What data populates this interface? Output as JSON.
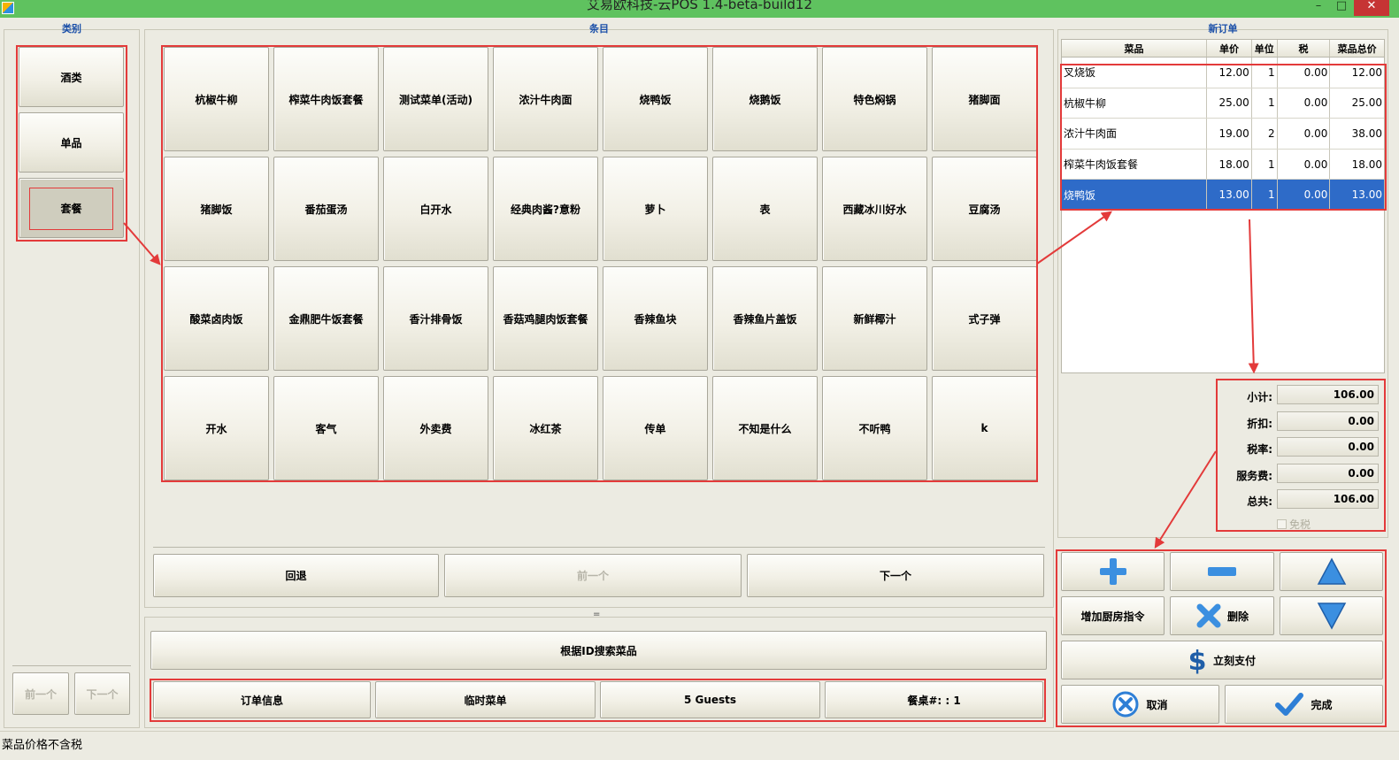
{
  "window": {
    "title": "艾易欧科技-云POS 1.4-beta-build12",
    "minimize": "–",
    "maximize": "□",
    "close": "✕"
  },
  "category_panel": {
    "title": "类别",
    "items": [
      "酒类",
      "单品",
      "套餐"
    ],
    "selected": "套餐",
    "prev": "前一个",
    "next": "下一个"
  },
  "items_panel": {
    "title": "条目",
    "items": [
      "杭椒牛柳",
      "榨菜牛肉饭套餐",
      "测试菜单(活动)",
      "浓汁牛肉面",
      "烧鸭饭",
      "烧鹅饭",
      "特色焖锅",
      "猪脚面",
      "猪脚饭",
      "番茄蛋汤",
      "白开水",
      "经典肉酱?意粉",
      "萝卜",
      "表",
      "西藏冰川好水",
      "豆腐汤",
      "酸菜卤肉饭",
      "金鼎肥牛饭套餐",
      "香汁排骨饭",
      "香菇鸡腿肉饭套餐",
      "香辣鱼块",
      "香辣鱼片盖饭",
      "新鲜椰汁",
      "式子弹",
      "开水",
      "客气",
      "外卖费",
      "冰红茶",
      "传单",
      "不知是什么",
      "不听鸭",
      "k"
    ],
    "back": "回退",
    "prev": "前一个",
    "next": "下一个",
    "splitter": "="
  },
  "bottom_bar": {
    "search": "根据ID搜索菜品",
    "order_info": "订单信息",
    "temp_menu": "临时菜单",
    "guests": "5 Guests",
    "table": "餐桌#: : 1"
  },
  "order_panel": {
    "title": "新订单",
    "columns": [
      "菜品",
      "单价",
      "单位",
      "税",
      "菜品总价"
    ],
    "rows": [
      [
        "叉烧饭",
        "12.00",
        "1",
        "0.00",
        "12.00"
      ],
      [
        "杭椒牛柳",
        "25.00",
        "1",
        "0.00",
        "25.00"
      ],
      [
        "浓汁牛肉面",
        "19.00",
        "2",
        "0.00",
        "38.00"
      ],
      [
        "榨菜牛肉饭套餐",
        "18.00",
        "1",
        "0.00",
        "18.00"
      ],
      [
        "烧鸭饭",
        "13.00",
        "1",
        "0.00",
        "13.00"
      ]
    ],
    "selected_row": 4
  },
  "totals": {
    "subtotal_label": "小计:",
    "subtotal": "106.00",
    "discount_label": "折扣:",
    "discount": "0.00",
    "tax_label": "税率:",
    "tax": "0.00",
    "service_label": "服务费:",
    "service": "0.00",
    "total_label": "总共:",
    "total": "106.00",
    "tax_free_label": "免税"
  },
  "actions": {
    "kitchen": "增加厨房指令",
    "delete": "删除",
    "pay": "立刻支付",
    "cancel": "取消",
    "done": "完成"
  },
  "status": {
    "text": "菜品价格不含税"
  },
  "colors": {
    "titlebar": "#5fc25f",
    "highlight": "#e33a3a",
    "selection": "#2e6bc8",
    "panel_title": "#1a4fa8"
  }
}
